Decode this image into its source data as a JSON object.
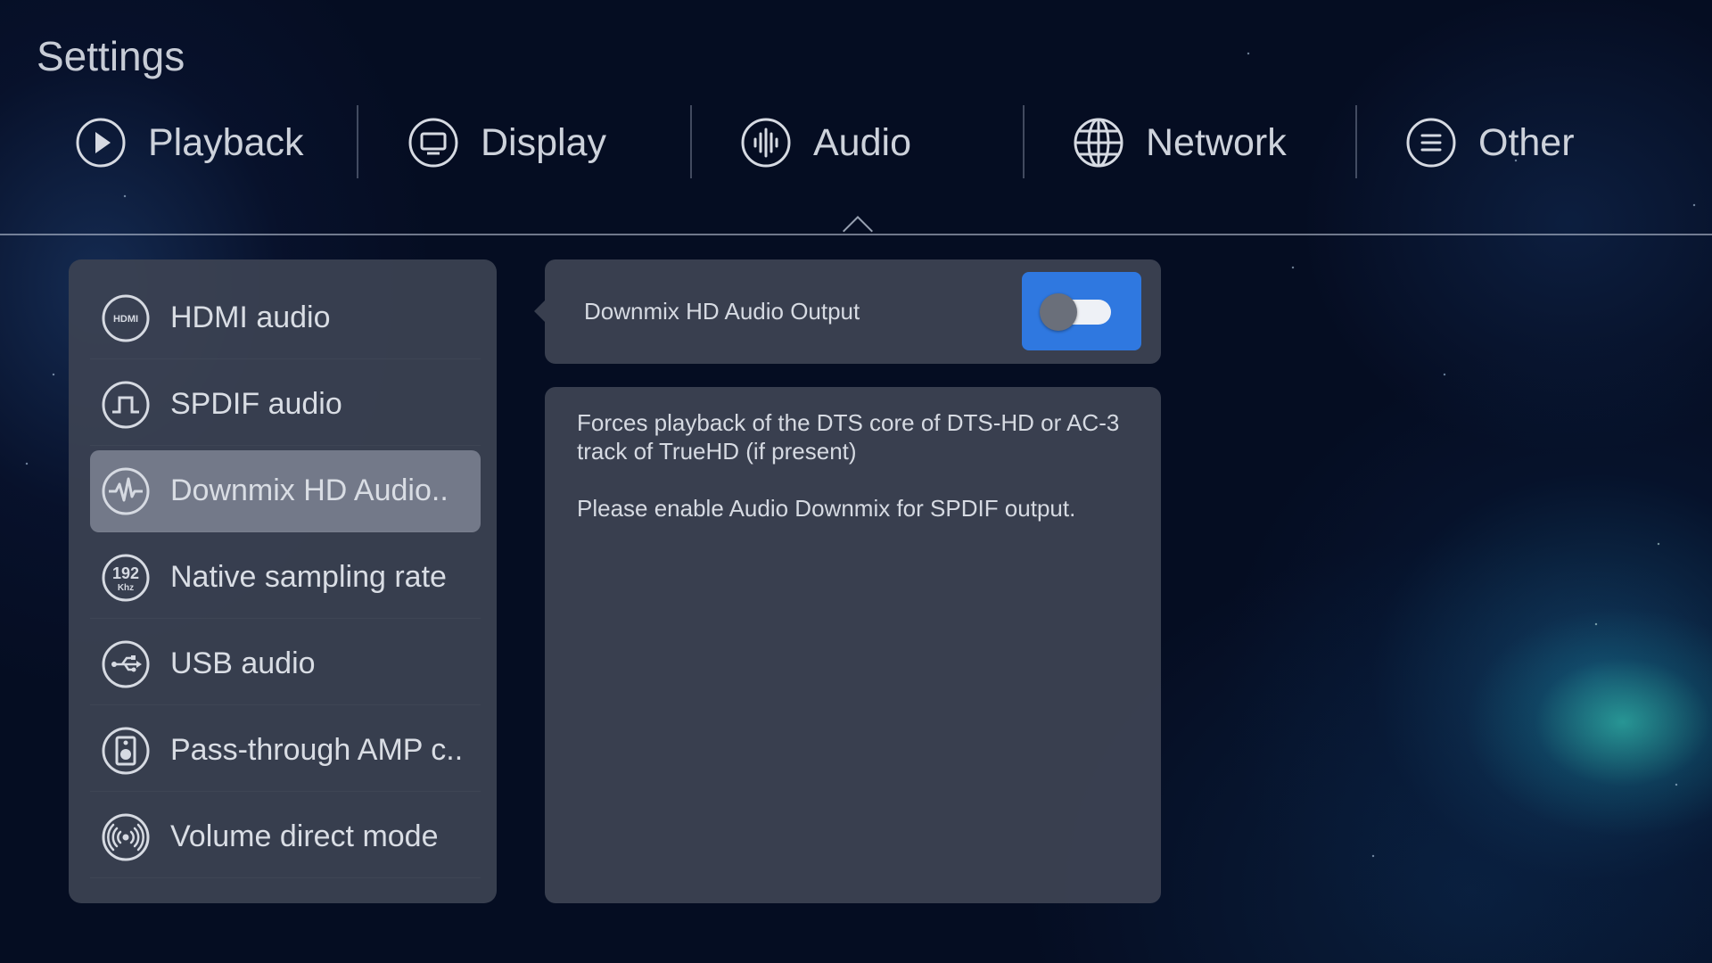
{
  "title": "Settings",
  "tabs": [
    {
      "label": "Playback",
      "icon": "play-icon"
    },
    {
      "label": "Display",
      "icon": "monitor-icon"
    },
    {
      "label": "Audio",
      "icon": "audio-wave-icon",
      "active": true
    },
    {
      "label": "Network",
      "icon": "globe-icon"
    },
    {
      "label": "Other",
      "icon": "menu-icon"
    }
  ],
  "audio_items": [
    {
      "label": "HDMI audio",
      "icon": "hdmi-icon"
    },
    {
      "label": "SPDIF audio",
      "icon": "spdif-icon"
    },
    {
      "label": "Downmix HD Audio..",
      "icon": "waveform-icon",
      "selected": true
    },
    {
      "label": "Native sampling rate",
      "icon": "sample-rate-icon",
      "icon_text": "192",
      "icon_subtext": "Khz"
    },
    {
      "label": "USB audio",
      "icon": "usb-icon"
    },
    {
      "label": "Pass-through AMP c..",
      "icon": "speaker-icon"
    },
    {
      "label": "Volume direct mode",
      "icon": "broadcast-icon"
    }
  ],
  "setting": {
    "label": "Downmix HD Audio Output",
    "toggle_on": false,
    "button_color": "#2f78e0"
  },
  "description": {
    "line1": "Forces playback of the DTS core of DTS-HD or AC-3 track of TrueHD (if present)",
    "line2": "Please enable Audio Downmix for SPDIF output."
  },
  "colors": {
    "background": "#050d22",
    "panel": "#3c4252",
    "selected_item": "#767c8c",
    "accent": "#2f78e0"
  }
}
